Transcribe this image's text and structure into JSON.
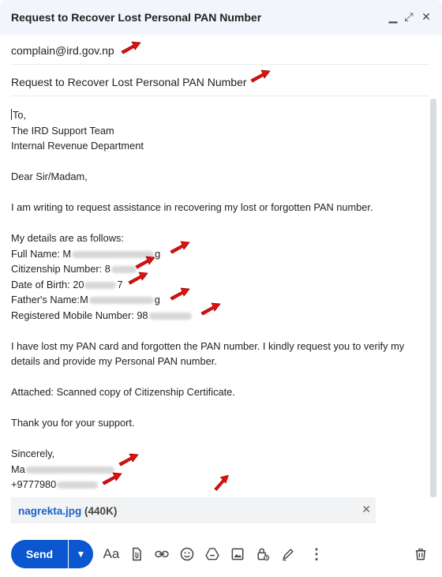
{
  "window": {
    "title": "Request to Recover Lost Personal PAN Number",
    "controls": {
      "minimize": "▁",
      "expand": "⤢",
      "close": "✕"
    }
  },
  "compose": {
    "to": "complain@ird.gov.np",
    "subject": "Request to Recover Lost Personal PAN Number",
    "body": {
      "greeting_to": "To,",
      "addr_line1": "The IRD Support Team",
      "addr_line2": "Internal Revenue Department",
      "salutation": "Dear Sir/Madam,",
      "intro": "I am writing to request assistance in recovering my lost or forgotten PAN number.",
      "details_header": "My details are as follows:",
      "full_name_label": "Full Name: M",
      "full_name_end": "g",
      "citizenship_label": "Citizenship Number: 8",
      "dob_label": "Date of Birth: 20",
      "dob_end": "7",
      "father_label": "Father's Name:M",
      "father_end": "g",
      "mobile_label": "Registered Mobile Number: 98",
      "request_line1": "I have lost my PAN card and forgotten the PAN number. I kindly request you to verify my",
      "request_line2": "details and provide my Personal PAN number.",
      "attached_line": "Attached: Scanned copy of Citizenship Certificate.",
      "thanks": "Thank you for your support.",
      "closing": "Sincerely,",
      "sign_name_start": "Ma",
      "sign_phone_start": "+9777980"
    },
    "attachment": {
      "name": "nagrekta.jpg",
      "size": "(440K)",
      "remove_icon": "✕"
    }
  },
  "toolbar": {
    "send_label": "Send",
    "send_options_icon": "▼",
    "icons": [
      "formatting-icon",
      "attach-file-icon",
      "link-icon",
      "emoji-icon",
      "drive-icon",
      "photo-icon",
      "confidential-lock-icon",
      "signature-pen-icon",
      "more-options-icon",
      "delete-trash-icon"
    ],
    "formatting_label": "Aa",
    "more_label": "⋮"
  },
  "colors": {
    "accent": "#0b57d0",
    "titlebar": "#f2f6fc",
    "arrow": "#e01010",
    "attachment_link": "#1a62c7"
  }
}
